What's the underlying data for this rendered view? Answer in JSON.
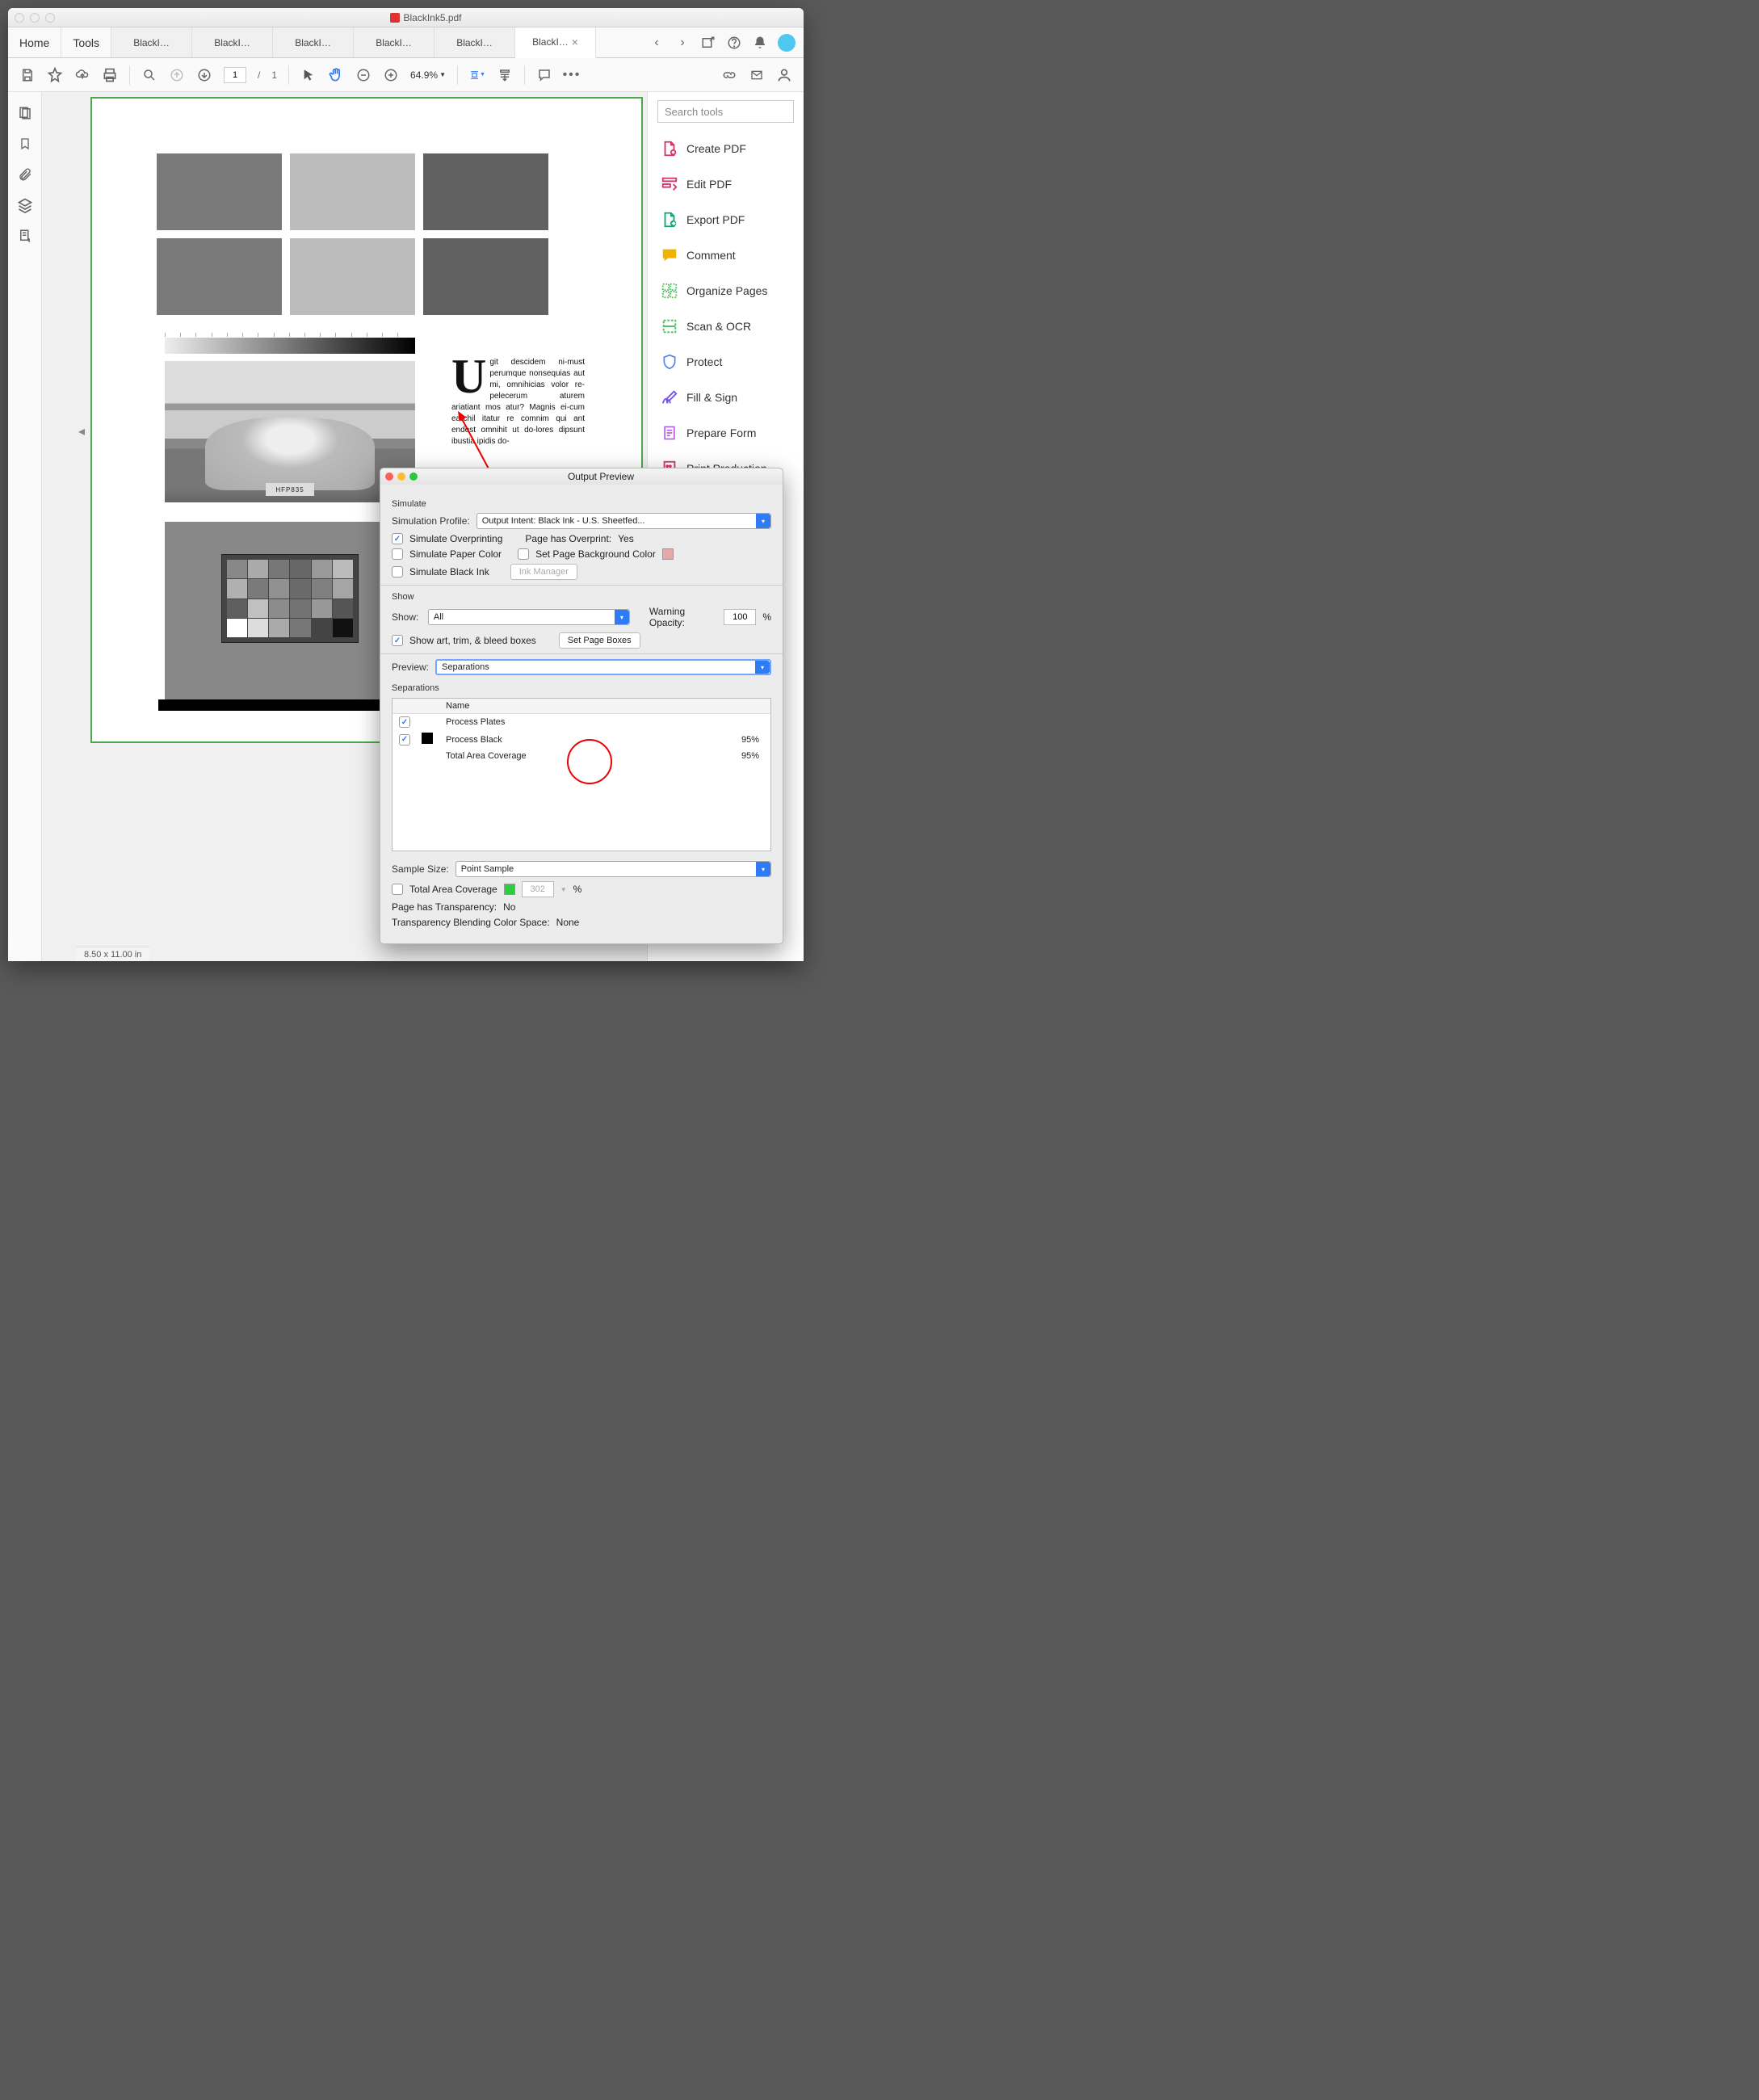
{
  "window": {
    "title": "BlackInk5.pdf"
  },
  "tabs": {
    "home": "Home",
    "tools": "Tools",
    "files": [
      "BlackI…",
      "BlackI…",
      "BlackI…",
      "BlackI…",
      "BlackI…",
      "BlackI…"
    ],
    "activeIndex": 5
  },
  "toolbar": {
    "page_current": "1",
    "page_sep": "/",
    "page_total": "1",
    "zoom": "64.9%"
  },
  "status": {
    "dims": "8.50 x 11.00 in"
  },
  "rightpanel": {
    "search_placeholder": "Search tools",
    "items": [
      {
        "name": "create-pdf",
        "label": "Create PDF",
        "color": "#d6336c",
        "icon": "file-plus"
      },
      {
        "name": "edit-pdf",
        "label": "Edit PDF",
        "color": "#d6336c",
        "icon": "edit"
      },
      {
        "name": "export-pdf",
        "label": "Export PDF",
        "color": "#0ca678",
        "icon": "file-export"
      },
      {
        "name": "comment",
        "label": "Comment",
        "color": "#f2b200",
        "icon": "comment"
      },
      {
        "name": "organize-pages",
        "label": "Organize Pages",
        "color": "#40c057",
        "icon": "organize"
      },
      {
        "name": "scan-ocr",
        "label": "Scan & OCR",
        "color": "#40c057",
        "icon": "scan"
      },
      {
        "name": "protect",
        "label": "Protect",
        "color": "#5c7cfa",
        "icon": "shield"
      },
      {
        "name": "fill-sign",
        "label": "Fill & Sign",
        "color": "#7950f2",
        "icon": "sign"
      },
      {
        "name": "prepare-form",
        "label": "Prepare Form",
        "color": "#b95de1",
        "icon": "form"
      },
      {
        "name": "print-production",
        "label": "Print Production",
        "color": "#d6336c",
        "icon": "print"
      }
    ]
  },
  "page_content": {
    "plate": "HFP835",
    "body": "git descidem ni-must perumque nonsequias aut mi, omnihicias volor re-pelecerum aturem ariatiant mos atur? Magnis ei-cum earchil itatur re comnim qui ant endest omnihit ut do-lores dipsunt ibustia ipidis do-"
  },
  "dialog": {
    "title": "Output Preview",
    "simulate": {
      "heading": "Simulate",
      "profile_label": "Simulation Profile:",
      "profile_value": "Output Intent: Black Ink - U.S. Sheetfed...",
      "overprint_label": "Simulate Overprinting",
      "overprint_note_label": "Page has Overprint:",
      "overprint_note_value": "Yes",
      "paper_label": "Simulate Paper Color",
      "bg_label": "Set Page Background Color",
      "bg_swatch": "#e6a7a7",
      "black_label": "Simulate Black Ink",
      "ink_mgr": "Ink Manager"
    },
    "show": {
      "heading": "Show",
      "show_label": "Show:",
      "show_value": "All",
      "warn_label": "Warning Opacity:",
      "warn_value": "100",
      "warn_unit": "%",
      "boxes_label": "Show art, trim, & bleed boxes",
      "setboxes": "Set Page Boxes"
    },
    "preview": {
      "label": "Preview:",
      "value": "Separations"
    },
    "separations": {
      "heading": "Separations",
      "name_col": "Name",
      "rows": [
        {
          "checked": true,
          "swatch": null,
          "name": "Process Plates",
          "value": ""
        },
        {
          "checked": true,
          "swatch": "#000000",
          "name": "Process Black",
          "value": "95%"
        },
        {
          "checked": null,
          "swatch": null,
          "name": "Total Area Coverage",
          "value": "95%"
        }
      ]
    },
    "sample": {
      "label": "Sample Size:",
      "value": "Point Sample"
    },
    "tac": {
      "label": "Total Area Coverage",
      "swatch": "#2ecc40",
      "value": "302",
      "unit": "%"
    },
    "transparency": {
      "has_label": "Page has Transparency:",
      "has_value": "No",
      "space_label": "Transparency Blending Color Space:",
      "space_value": "None"
    }
  }
}
